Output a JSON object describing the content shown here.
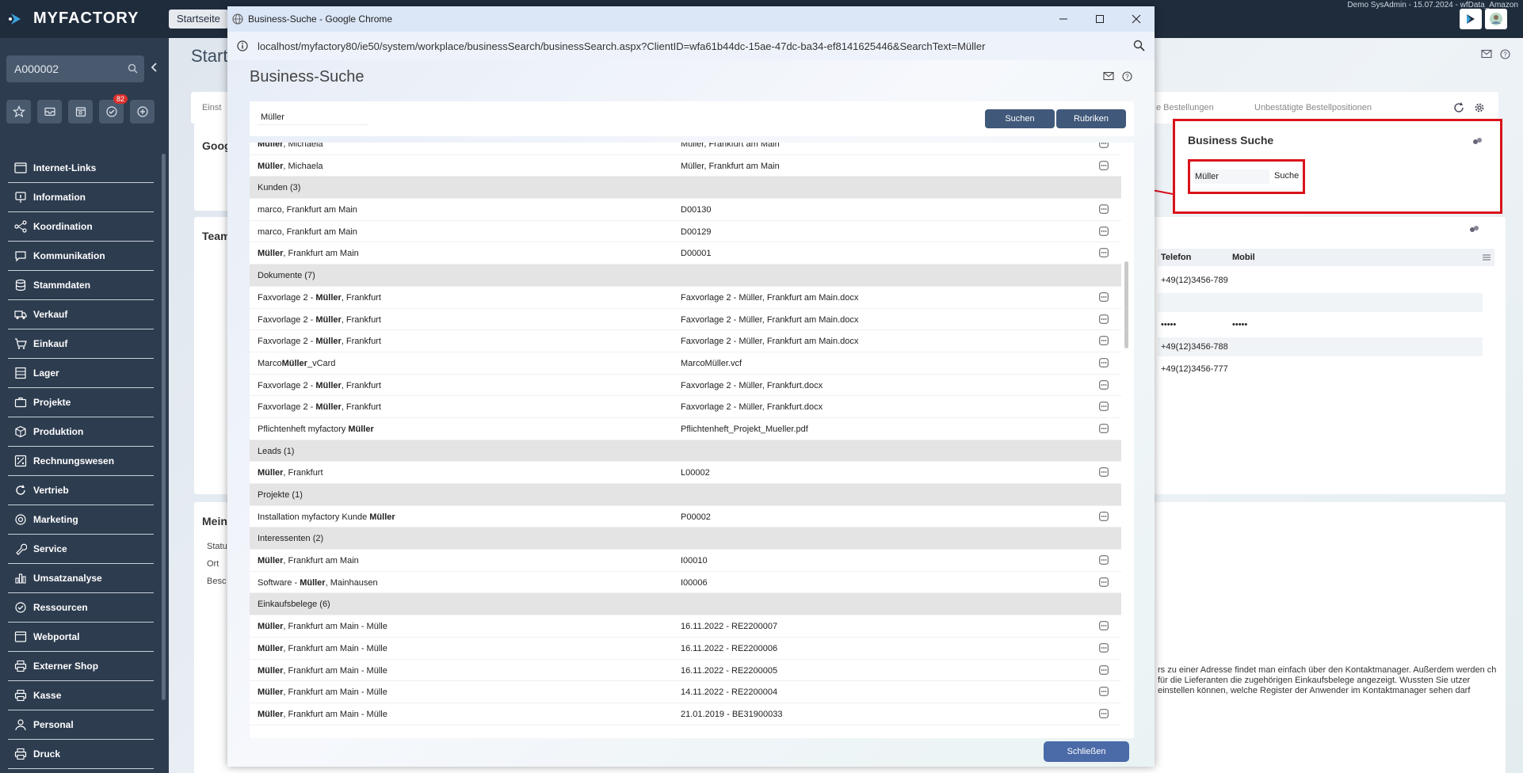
{
  "app": {
    "brand": "MYFACTORY",
    "top_tab": "Startseite",
    "user_info": "Demo SysAdmin - 15.07.2024 - wfData_Amazon"
  },
  "sidebar": {
    "search_value": "A000002",
    "badge_count": "82",
    "items": [
      {
        "label": "Internet-Links",
        "icon": "link-icon"
      },
      {
        "label": "Information",
        "icon": "info-icon"
      },
      {
        "label": "Koordination",
        "icon": "share-icon"
      },
      {
        "label": "Kommunikation",
        "icon": "chat-icon"
      },
      {
        "label": "Stammdaten",
        "icon": "database-icon"
      },
      {
        "label": "Verkauf",
        "icon": "truck-icon"
      },
      {
        "label": "Einkauf",
        "icon": "cart-icon"
      },
      {
        "label": "Lager",
        "icon": "shelf-icon"
      },
      {
        "label": "Projekte",
        "icon": "briefcase-icon"
      },
      {
        "label": "Produktion",
        "icon": "box-icon"
      },
      {
        "label": "Rechnungswesen",
        "icon": "percent-icon"
      },
      {
        "label": "Vertrieb",
        "icon": "refresh-icon"
      },
      {
        "label": "Marketing",
        "icon": "target-icon"
      },
      {
        "label": "Service",
        "icon": "wrench-icon"
      },
      {
        "label": "Umsatzanalyse",
        "icon": "bar-chart-icon"
      },
      {
        "label": "Ressourcen",
        "icon": "check-circle-icon"
      },
      {
        "label": "Webportal",
        "icon": "window-icon"
      },
      {
        "label": "Externer Shop",
        "icon": "printer-icon"
      },
      {
        "label": "Kasse",
        "icon": "printer-icon"
      },
      {
        "label": "Personal",
        "icon": "person-icon"
      },
      {
        "label": "Druck",
        "icon": "printer-icon"
      }
    ]
  },
  "background": {
    "title": "Start",
    "tab_first": "Einst",
    "tab_a": "e Bestellungen",
    "tab_b": "Unbestätigte Bestellpositionen",
    "google_title": "Goog",
    "team_title": "Team",
    "team_headers": {
      "telefon": "Telefon",
      "mobil": "Mobil"
    },
    "team_rows": [
      {
        "telefon": "+49(12)3456-789",
        "mobil": ""
      },
      {
        "telefon": "",
        "mobil": ""
      },
      {
        "telefon": "•••••",
        "mobil": "•••••"
      },
      {
        "telefon": "+49(12)3456-788",
        "mobil": ""
      },
      {
        "telefon": "+49(12)3456-777",
        "mobil": ""
      }
    ],
    "mein_title": "Mein",
    "mein_labels": [
      "Statu",
      "Ort",
      "Besc"
    ],
    "mein_text": "rs zu einer Adresse findet man einfach über den Kontaktmanager. Außerdem werden ch für die Lieferanten die zugehörigen Einkaufsbelege angezeigt. Wussten Sie utzer einstellen können, welche Register der Anwender im Kontaktmanager sehen darf",
    "bs_widget": {
      "title": "Business Suche",
      "input": "Müller",
      "button": "Suche"
    }
  },
  "popup": {
    "window_title": "Business-Suche - Google Chrome",
    "url": "localhost/myfactory80/ie50/system/workplace/businessSearch/businessSearch.aspx?ClientID=wfa61b44dc-15ae-47dc-ba34-ef8141625446&SearchText=Müller",
    "title": "Business-Suche",
    "search_value": "Müller",
    "btn_suchen": "Suchen",
    "btn_rubriken": "Rubriken",
    "btn_close": "Schließen",
    "rows": [
      {
        "type": "item",
        "c1": "Müller, Michaela",
        "c2": "Müller, Frankfurt am Main"
      },
      {
        "type": "item",
        "c1": "Müller, Michaela",
        "c2": "Müller, Frankfurt am Main"
      },
      {
        "type": "group",
        "c1": "Kunden (3)"
      },
      {
        "type": "item",
        "c1": "marco, Frankfurt am Main",
        "c2": "D00130"
      },
      {
        "type": "item",
        "c1": "marco, Frankfurt am Main",
        "c2": "D00129"
      },
      {
        "type": "item",
        "c1": "Müller, Frankfurt am Main",
        "c2": "D00001"
      },
      {
        "type": "group",
        "c1": "Dokumente (7)"
      },
      {
        "type": "item",
        "c1": "Faxvorlage 2 - Müller, Frankfurt",
        "c2": "Faxvorlage 2 - Müller, Frankfurt am Main.docx"
      },
      {
        "type": "item",
        "c1": "Faxvorlage 2 - Müller, Frankfurt",
        "c2": "Faxvorlage 2 - Müller, Frankfurt am Main.docx"
      },
      {
        "type": "item",
        "c1": "Faxvorlage 2 - Müller, Frankfurt",
        "c2": "Faxvorlage 2 - Müller, Frankfurt am Main.docx"
      },
      {
        "type": "item",
        "c1": "MarcoMüller_vCard",
        "c2": "MarcoMüller.vcf"
      },
      {
        "type": "item",
        "c1": "Faxvorlage 2 - Müller, Frankfurt",
        "c2": "Faxvorlage 2 - Müller, Frankfurt.docx"
      },
      {
        "type": "item",
        "c1": "Faxvorlage 2 - Müller, Frankfurt",
        "c2": "Faxvorlage 2 - Müller, Frankfurt.docx"
      },
      {
        "type": "item",
        "c1": "Pflichtenheft myfactory Müller",
        "c2": "Pflichtenheft_Projekt_Mueller.pdf"
      },
      {
        "type": "group",
        "c1": "Leads (1)"
      },
      {
        "type": "item",
        "c1": "Müller, Frankfurt",
        "c2": "L00002"
      },
      {
        "type": "group",
        "c1": "Projekte (1)"
      },
      {
        "type": "item",
        "c1": "Installation myfactory Kunde Müller",
        "c2": "P00002"
      },
      {
        "type": "group",
        "c1": "Interessenten (2)"
      },
      {
        "type": "item",
        "c1": "Müller, Frankfurt am Main",
        "c2": "I00010"
      },
      {
        "type": "item",
        "c1": "Software - Müller, Mainhausen",
        "c2": "I00006"
      },
      {
        "type": "group",
        "c1": "Einkaufsbelege (6)"
      },
      {
        "type": "item",
        "c1": "Müller, Frankfurt am Main - Mülle",
        "c2": "16.11.2022 - RE2200007"
      },
      {
        "type": "item",
        "c1": "Müller, Frankfurt am Main - Mülle",
        "c2": "16.11.2022 - RE2200006"
      },
      {
        "type": "item",
        "c1": "Müller, Frankfurt am Main - Mülle",
        "c2": "16.11.2022 - RE2200005"
      },
      {
        "type": "item",
        "c1": "Müller, Frankfurt am Main - Mülle",
        "c2": "14.11.2022 - RE2200004"
      },
      {
        "type": "item",
        "c1": "Müller, Frankfurt am Main - Mülle",
        "c2": "21.01.2019 - BE31900033"
      }
    ]
  },
  "colors": {
    "topbar": "#1f2c3c",
    "sidebar": "#2d3c4f",
    "button_dark": "#40587a",
    "highlight_red": "#d9131a"
  }
}
